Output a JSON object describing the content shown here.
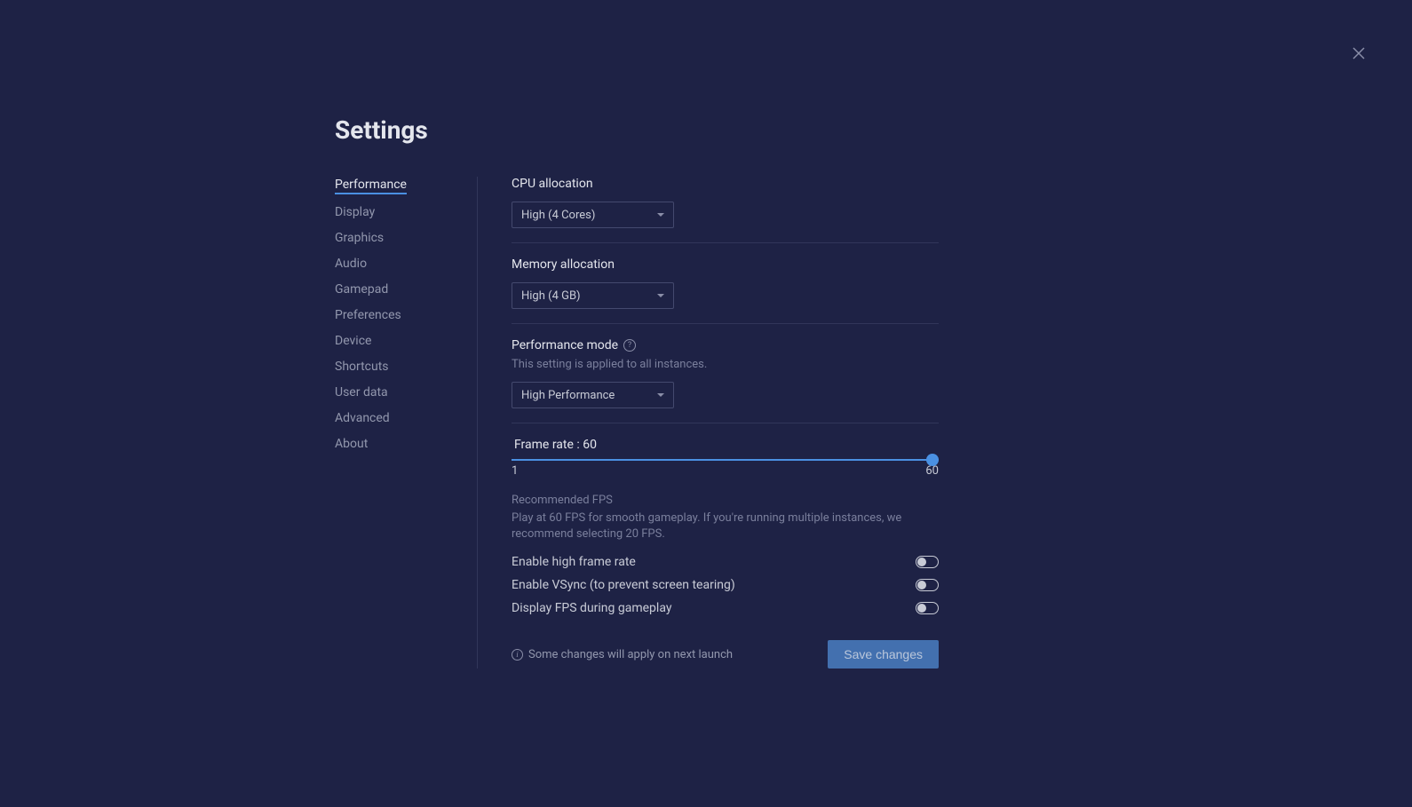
{
  "title": "Settings",
  "nav": {
    "items": [
      "Performance",
      "Display",
      "Graphics",
      "Audio",
      "Gamepad",
      "Preferences",
      "Device",
      "Shortcuts",
      "User data",
      "Advanced",
      "About"
    ],
    "activeIndex": 0
  },
  "cpu": {
    "label": "CPU allocation",
    "value": "High (4 Cores)"
  },
  "memory": {
    "label": "Memory allocation",
    "value": "High (4 GB)"
  },
  "performanceMode": {
    "label": "Performance mode",
    "description": "This setting is applied to all instances.",
    "value": "High Performance"
  },
  "frameRate": {
    "label": "Frame rate : 60",
    "min": "1",
    "max": "60",
    "value": 60,
    "recommendedTitle": "Recommended FPS",
    "recommendedDesc": "Play at 60 FPS for smooth gameplay. If you're running multiple instances, we recommend selecting 20 FPS."
  },
  "toggles": {
    "highFrameRate": {
      "label": "Enable high frame rate",
      "enabled": false
    },
    "vsync": {
      "label": "Enable VSync (to prevent screen tearing)",
      "enabled": false
    },
    "displayFps": {
      "label": "Display FPS during gameplay",
      "enabled": false
    }
  },
  "footer": {
    "notice": "Some changes will apply on next launch",
    "saveButton": "Save changes"
  }
}
